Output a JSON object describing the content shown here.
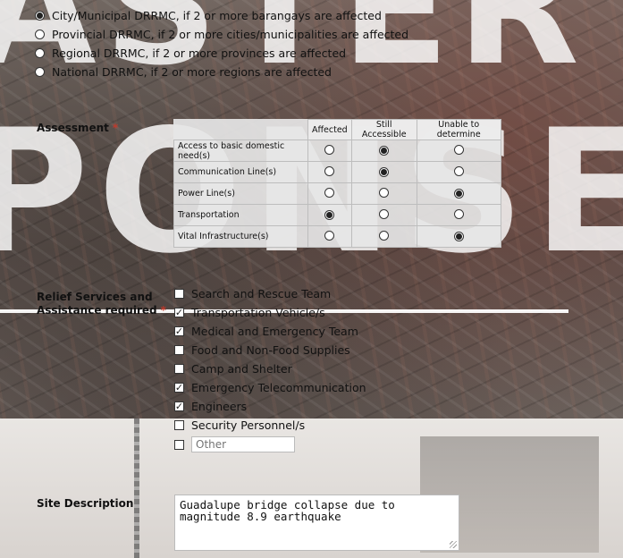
{
  "background": {
    "word_top": "ASTER",
    "word_bottom": "PONSE"
  },
  "level_options": [
    {
      "label": "City/Municipal DRRMC, if 2 or more barangays are affected",
      "selected": true
    },
    {
      "label": "Provincial DRRMC, if 2 or more cities/municipalities are affected",
      "selected": false
    },
    {
      "label": "Regional DRRMC, if 2 or more provinces are affected",
      "selected": false
    },
    {
      "label": "National DRRMC, if 2 or more regions are affected",
      "selected": false
    }
  ],
  "assessment": {
    "label": "Assessment",
    "required_mark": "*",
    "columns": [
      "Affected",
      "Still Accessible",
      "Unable to determine"
    ],
    "rows": [
      {
        "label": "Access to basic domestic need(s)",
        "selected": "Still Accessible"
      },
      {
        "label": "Communication Line(s)",
        "selected": "Still Accessible"
      },
      {
        "label": "Power Line(s)",
        "selected": "Unable to determine"
      },
      {
        "label": "Transportation",
        "selected": "Affected"
      },
      {
        "label": "Vital Infrastructure(s)",
        "selected": "Unable to determine"
      }
    ]
  },
  "relief": {
    "label_line1": "Relief Services and",
    "label_line2": "Assistance required",
    "required_mark": "*",
    "options": [
      {
        "label": "Search and Rescue Team",
        "checked": false
      },
      {
        "label": "Transportation Vehicle/s",
        "checked": true
      },
      {
        "label": "Medical and Emergency Team",
        "checked": true
      },
      {
        "label": "Food and Non-Food Supplies",
        "checked": false
      },
      {
        "label": "Camp and Shelter",
        "checked": false
      },
      {
        "label": "Emergency Telecommunication",
        "checked": true
      },
      {
        "label": "Engineers",
        "checked": true
      },
      {
        "label": "Security Personnel/s",
        "checked": false
      }
    ],
    "other_placeholder": "Other",
    "other_checked": false
  },
  "site": {
    "label": "Site Description",
    "value": "Guadalupe bridge collapse due to magnitude 8.9 earthquake"
  }
}
